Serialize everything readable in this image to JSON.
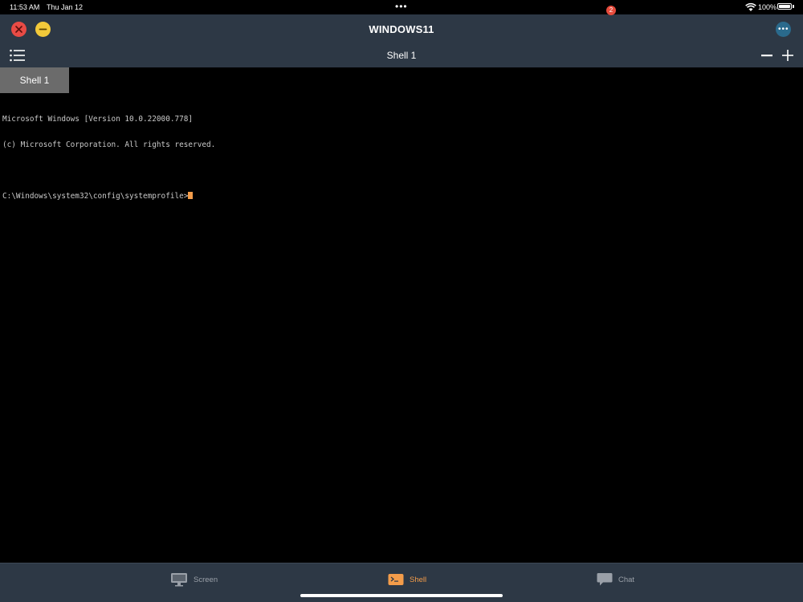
{
  "status_bar": {
    "time": "11:53 AM",
    "date": "Thu Jan 12",
    "battery": "100%"
  },
  "window": {
    "title": "WINDOWS11"
  },
  "toolbar": {
    "label": "Shell 1"
  },
  "tabs": [
    {
      "label": "Shell 1"
    }
  ],
  "terminal": {
    "lines": [
      "Microsoft Windows [Version 10.0.22000.778]",
      "(c) Microsoft Corporation. All rights reserved.",
      "",
      "C:\\Windows\\system32\\config\\systemprofile>"
    ]
  },
  "bottom_nav": {
    "items": [
      {
        "label": "Screen",
        "icon": "monitor-icon"
      },
      {
        "label": "Shell",
        "icon": "terminal-icon"
      },
      {
        "label": "Chat",
        "icon": "chat-bubble-icon"
      }
    ],
    "chat_badge": "2"
  },
  "colors": {
    "header": "#2d3845",
    "close": "#e94b45",
    "minimize": "#f2c93a",
    "accent": "#f39c4a",
    "badge": "#e64b3c"
  }
}
